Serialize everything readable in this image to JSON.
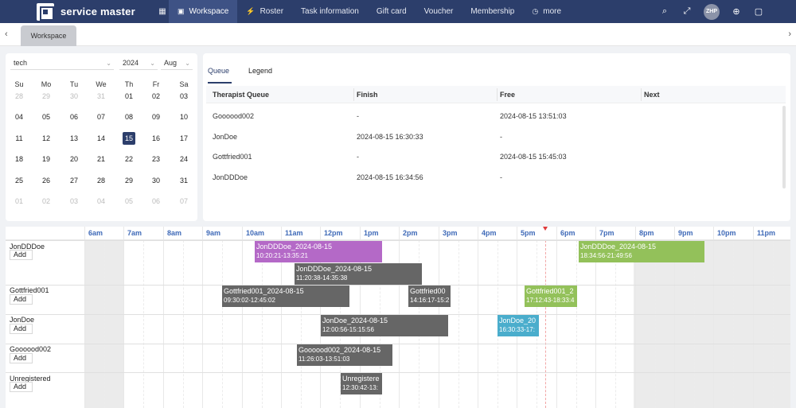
{
  "app": {
    "brand": "service master",
    "nav": [
      {
        "label": "Workspace",
        "icon": "workspace-icon",
        "active": true
      },
      {
        "label": "Roster",
        "icon": "roster-icon"
      },
      {
        "label": "Task information"
      },
      {
        "label": "Gift card"
      },
      {
        "label": "Voucher"
      },
      {
        "label": "Membership"
      },
      {
        "label": "more",
        "icon": "clock-icon"
      }
    ],
    "avatar": "ZHP"
  },
  "tabs": {
    "active": "Workspace"
  },
  "calendar": {
    "tech_select": "tech",
    "year": "2024",
    "month": "Aug",
    "weekdays": [
      "Su",
      "Mo",
      "Tu",
      "We",
      "Th",
      "Fr",
      "Sa"
    ],
    "weeks": [
      [
        "28",
        "29",
        "30",
        "31",
        "01",
        "02",
        "03"
      ],
      [
        "04",
        "05",
        "06",
        "07",
        "08",
        "09",
        "10"
      ],
      [
        "11",
        "12",
        "13",
        "14",
        "15",
        "16",
        "17"
      ],
      [
        "18",
        "19",
        "20",
        "21",
        "22",
        "23",
        "24"
      ],
      [
        "25",
        "26",
        "27",
        "28",
        "29",
        "30",
        "31"
      ],
      [
        "01",
        "02",
        "03",
        "04",
        "05",
        "06",
        "07"
      ]
    ],
    "selected": "15"
  },
  "queue": {
    "tabs": [
      "Queue",
      "Legend"
    ],
    "columns": [
      "Therapist Queue",
      "Finish",
      "Free",
      "Next"
    ],
    "rows": [
      [
        "Goooood002",
        "-",
        "2024-08-15 13:51:03",
        ""
      ],
      [
        "JonDoe",
        "2024-08-15 16:30:33",
        "-",
        ""
      ],
      [
        "Gottfried001",
        "-",
        "2024-08-15 15:45:03",
        ""
      ],
      [
        "JonDDDoe",
        "2024-08-15 16:34:56",
        "-",
        ""
      ]
    ]
  },
  "timeline": {
    "hours": [
      "6am",
      "7am",
      "8am",
      "9am",
      "10am",
      "11am",
      "12pm",
      "1pm",
      "2pm",
      "3pm",
      "4pm",
      "5pm",
      "6pm",
      "7pm",
      "8pm",
      "9pm",
      "10pm",
      "11pm"
    ],
    "add_label": "Add",
    "rows": [
      {
        "name": "JonDDDoe"
      },
      {
        "name": "Gottfried001"
      },
      {
        "name": "JonDoe"
      },
      {
        "name": "Goooood002"
      },
      {
        "name": "Unregistered"
      }
    ],
    "bookings": [
      {
        "title": "JonDDDoe_2024-08-15",
        "time": "10:20:21-13:35:21",
        "color": "#b469c7"
      },
      {
        "title": "JonDDDoe_2024-08-15",
        "time": "11:20:38-14:35:38",
        "color": "#666666"
      },
      {
        "title": "JonDDDoe_2024-08-15",
        "time": "18:34:56-21:49:56",
        "color": "#93c15a"
      },
      {
        "title": "Gottfried001_2024-08-15",
        "time": "09:30:02-12:45:02",
        "color": "#666666"
      },
      {
        "title": "Gottfried00",
        "time": "14:16:17-15:2",
        "color": "#666666"
      },
      {
        "title": "Gottfried001_2",
        "time": "17:12:43-18:33:4",
        "color": "#93c15a"
      },
      {
        "title": "JonDoe_2024-08-15",
        "time": "12:00:56-15:15:56",
        "color": "#666666"
      },
      {
        "title": "JonDoe_20",
        "time": "16:30:33-17:",
        "color": "#4aadcc"
      },
      {
        "title": "Goooood002_2024-08-15",
        "time": "11:26:03-13:51:03",
        "color": "#666666"
      },
      {
        "title": "Unregistere",
        "time": "12:30:42-13:",
        "color": "#666666"
      }
    ]
  }
}
